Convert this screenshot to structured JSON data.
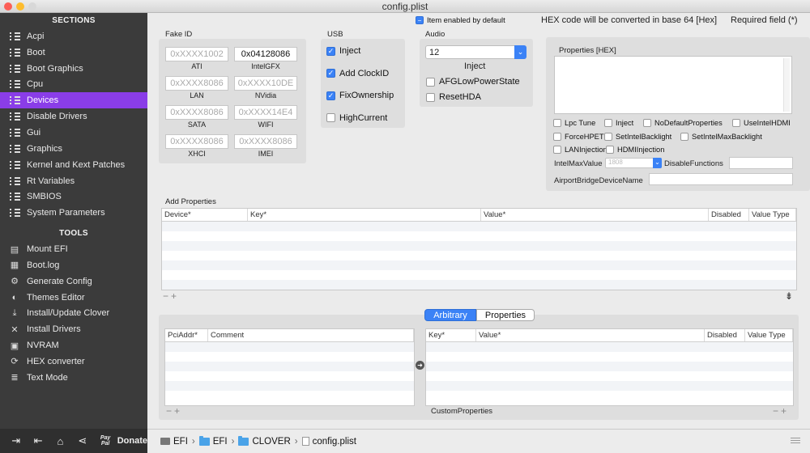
{
  "window": {
    "title": "config.plist"
  },
  "sidebar": {
    "sections_title": "SECTIONS",
    "sections": [
      {
        "label": "Acpi",
        "icon": "list-icon"
      },
      {
        "label": "Boot",
        "icon": "list-icon"
      },
      {
        "label": "Boot Graphics",
        "icon": "list-icon"
      },
      {
        "label": "Cpu",
        "icon": "list-icon"
      },
      {
        "label": "Devices",
        "icon": "list-icon",
        "selected": true
      },
      {
        "label": "Disable Drivers",
        "icon": "list-icon"
      },
      {
        "label": "Gui",
        "icon": "list-icon"
      },
      {
        "label": "Graphics",
        "icon": "list-icon"
      },
      {
        "label": "Kernel and Kext Patches",
        "icon": "list-icon"
      },
      {
        "label": "Rt Variables",
        "icon": "list-icon"
      },
      {
        "label": "SMBIOS",
        "icon": "list-icon"
      },
      {
        "label": "System Parameters",
        "icon": "list-icon"
      }
    ],
    "tools_title": "TOOLS",
    "tools": [
      {
        "label": "Mount EFI",
        "icon": "drive-icon"
      },
      {
        "label": "Boot.log",
        "icon": "log-icon"
      },
      {
        "label": "Generate Config",
        "icon": "gear-icon"
      },
      {
        "label": "Themes Editor",
        "icon": "palette-icon"
      },
      {
        "label": "Install/Update Clover",
        "icon": "download-icon"
      },
      {
        "label": "Install Drivers",
        "icon": "wrench-icon"
      },
      {
        "label": "NVRAM",
        "icon": "chip-icon"
      },
      {
        "label": "HEX converter",
        "icon": "refresh-icon"
      },
      {
        "label": "Text Mode",
        "icon": "text-icon"
      }
    ],
    "bottom": {
      "paypal": "Pay Pal",
      "donate": "Donate"
    },
    "selected_color": "#8a3de8"
  },
  "header": {
    "item_enabled": "Item enabled by default",
    "hex_note": "HEX code will be converted in base 64 [Hex]",
    "required": "Required field (*)"
  },
  "fake_id": {
    "title": "Fake ID",
    "fields": [
      {
        "value": "",
        "placeholder": "0xXXXX1002",
        "label": "ATI"
      },
      {
        "value": "0x04128086",
        "placeholder": "",
        "label": "IntelGFX"
      },
      {
        "value": "",
        "placeholder": "0xXXXX8086",
        "label": "LAN"
      },
      {
        "value": "",
        "placeholder": "0xXXXX10DE",
        "label": "NVidia"
      },
      {
        "value": "",
        "placeholder": "0xXXXX8086",
        "label": "SATA"
      },
      {
        "value": "",
        "placeholder": "0xXXXX14E4",
        "label": "WIFI"
      },
      {
        "value": "",
        "placeholder": "0xXXXX8086",
        "label": "XHCI"
      },
      {
        "value": "",
        "placeholder": "0xXXXX8086",
        "label": "IMEI"
      }
    ]
  },
  "usb": {
    "title": "USB",
    "options": [
      {
        "label": "Inject",
        "checked": true
      },
      {
        "label": "Add ClockID",
        "checked": true
      },
      {
        "label": "FixOwnership",
        "checked": true
      },
      {
        "label": "HighCurrent",
        "checked": false
      }
    ]
  },
  "audio": {
    "title": "Audio",
    "inject_value": "12",
    "inject_label": "Inject",
    "options": [
      {
        "label": "AFGLowPowerState",
        "checked": false
      },
      {
        "label": "ResetHDA",
        "checked": false
      }
    ]
  },
  "properties_hex": {
    "title": "Properties [HEX]",
    "value": ""
  },
  "flags": [
    {
      "label": "Lpc Tune",
      "checked": false
    },
    {
      "label": "Inject",
      "checked": false
    },
    {
      "label": "NoDefaultProperties",
      "checked": false
    },
    {
      "label": "UseIntelHDMI",
      "checked": false
    },
    {
      "label": "ForceHPET",
      "checked": false
    },
    {
      "label": "SetIntelBacklight",
      "checked": false
    },
    {
      "label": "SetIntelMaxBacklight",
      "checked": false
    },
    {
      "label": "LANInjection",
      "checked": false
    },
    {
      "label": "HDMIInjection",
      "checked": false
    }
  ],
  "intel_max_value": {
    "label": "IntelMaxValue",
    "placeholder": "1808"
  },
  "disable_functions": {
    "label": "DisableFunctions",
    "value": ""
  },
  "airport": {
    "label": "AirportBridgeDeviceName",
    "value": ""
  },
  "add_properties": {
    "title": "Add Properties",
    "columns": [
      "Device*",
      "Key*",
      "Value*",
      "Disabled",
      "Value Type"
    ]
  },
  "segmented": {
    "tabs": [
      "Arbitrary",
      "Properties"
    ],
    "selected": 0
  },
  "arbitrary_left": {
    "columns": [
      "PciAddr*",
      "Comment"
    ]
  },
  "arbitrary_right": {
    "columns": [
      "Key*",
      "Value*",
      "Disabled",
      "Value Type"
    ],
    "footer": "CustomProperties"
  },
  "pathbar": {
    "items": [
      "EFI",
      "EFI",
      "CLOVER",
      "config.plist"
    ]
  },
  "colors": {
    "accent": "#3b82f6",
    "sidebar": "#3b3b3b"
  }
}
